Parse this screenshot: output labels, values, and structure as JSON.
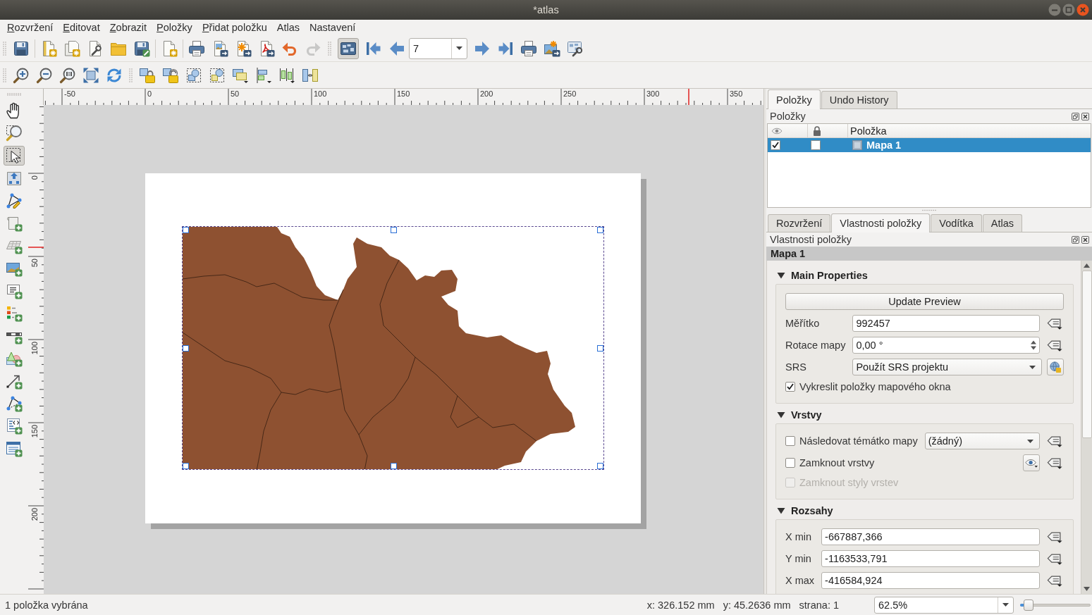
{
  "window": {
    "title": "*atlas"
  },
  "menu": [
    {
      "label": "Rozvržení",
      "mnemonic": true
    },
    {
      "label": "Editovat",
      "mnemonic": true
    },
    {
      "label": "Zobrazit",
      "mnemonic": true
    },
    {
      "label": "Položky",
      "mnemonic": true
    },
    {
      "label": "Přidat položku",
      "mnemonic": true
    },
    {
      "label": "Atlas",
      "mnemonic": false
    },
    {
      "label": "Nastavení",
      "mnemonic": false
    }
  ],
  "toolbar": {
    "atlas_preview": {
      "on": true
    },
    "redo": {
      "disabled": true
    },
    "atlas_page": "7"
  },
  "tools": [
    {
      "selected": false
    },
    {
      "selected": false
    },
    {
      "selected": true
    },
    {
      "selected": false
    },
    {
      "selected": false
    },
    {
      "selected": false
    },
    {
      "selected": false
    },
    {
      "selected": false
    },
    {
      "selected": false
    },
    {
      "selected": false
    },
    {
      "selected": false
    },
    {
      "selected": false
    },
    {
      "selected": false
    },
    {
      "selected": false
    },
    {
      "selected": false
    },
    {
      "selected": false
    }
  ],
  "rulers": {
    "horizontal": [
      "-50",
      "0",
      "50",
      "100",
      "150",
      "200",
      "250",
      "300",
      "350"
    ],
    "vertical": [
      "0",
      "50",
      "100",
      "150",
      "200"
    ]
  },
  "canvas": {
    "map_item": {
      "selected": true
    }
  },
  "items_panel": {
    "tabs": [
      {
        "label": "Položky",
        "selected": true
      },
      {
        "label": "Undo History",
        "selected": false
      }
    ],
    "title": "Položky",
    "column": "Položka",
    "rows": [
      {
        "visible": true,
        "locked": false,
        "name": "Mapa 1",
        "selected": true
      }
    ]
  },
  "properties_panel": {
    "tabs": [
      {
        "label": "Rozvržení",
        "selected": false
      },
      {
        "label": "Vlastnosti položky",
        "selected": true
      },
      {
        "label": "Vodítka",
        "selected": false
      },
      {
        "label": "Atlas",
        "selected": false
      }
    ],
    "title": "Vlastnosti položky",
    "item_name": "Mapa 1",
    "sections": [
      {
        "title": "Main Properties",
        "expanded": true,
        "rows": [
          {
            "kind": "button",
            "label": "Update Preview"
          },
          {
            "kind": "text",
            "label": "Měřítko",
            "value": "992457"
          },
          {
            "kind": "spin",
            "label": "Rotace mapy",
            "value": "0,00 °"
          },
          {
            "kind": "crs",
            "label": "SRS",
            "value": "Použít SRS projektu"
          },
          {
            "kind": "checkbox",
            "label": "Vykreslit položky mapového okna",
            "checked": true,
            "disabled": false
          }
        ]
      },
      {
        "title": "Vrstvy",
        "expanded": true,
        "rows": [
          {
            "kind": "checkbox_combo",
            "label": "Následovat témátko mapy",
            "checked": false,
            "disabled": false,
            "value": "(žádný)"
          },
          {
            "kind": "checkbox_visibility",
            "label": "Zamknout vrstvy",
            "checked": false,
            "disabled": false
          },
          {
            "kind": "checkbox",
            "label": "Zamknout styly vrstev",
            "checked": false,
            "disabled": true
          }
        ]
      },
      {
        "title": "Rozsahy",
        "expanded": true,
        "rows": [
          {
            "kind": "text",
            "label": "X min",
            "value": "-667887,366"
          },
          {
            "kind": "text",
            "label": "Y min",
            "value": "-1163533,791"
          },
          {
            "kind": "text",
            "label": "X max",
            "value": "-416584,924"
          }
        ]
      }
    ]
  },
  "status_bar": {
    "message": "1 položka vybrána",
    "cursor_x": "x: 326.152 mm",
    "cursor_y": "y: 45.2636 mm",
    "page": "strana: 1",
    "zoom": "62.5%",
    "zoom_slider": {
      "level": 0.06
    }
  }
}
